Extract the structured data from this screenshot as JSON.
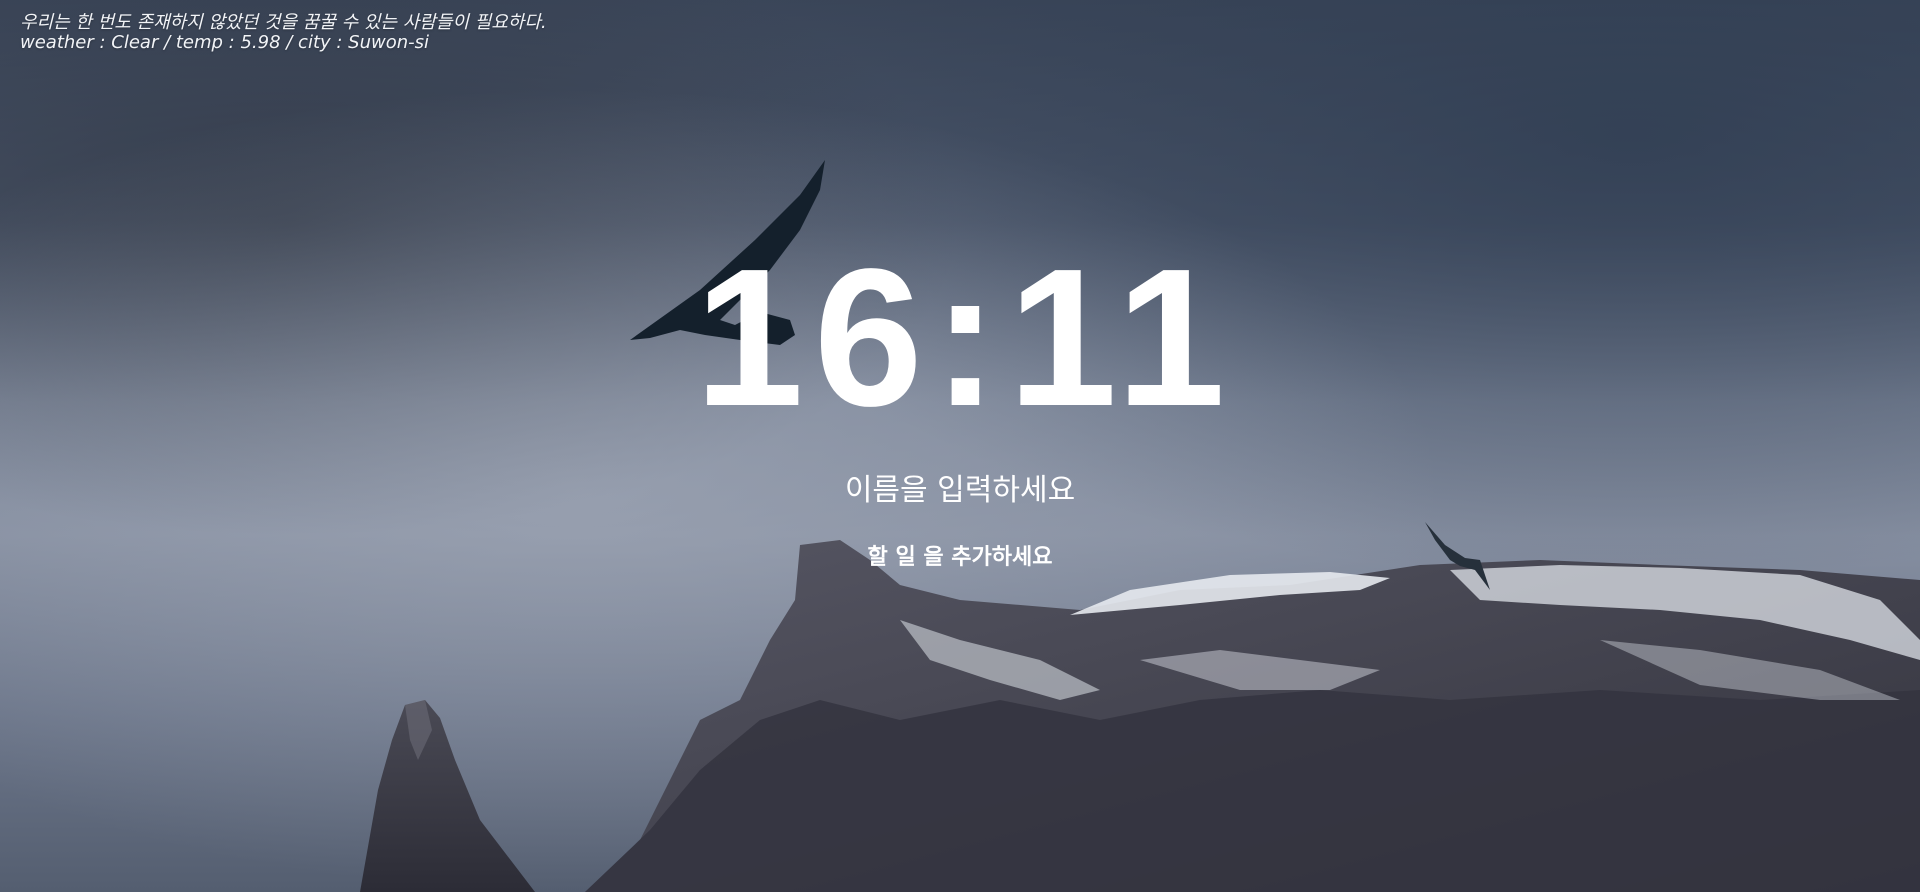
{
  "background": {
    "scene": "mountain-cliffs-with-seabirds"
  },
  "quote": {
    "text": "우리는 한 번도 존재하지 않았던 것을 꿈꿀 수 있는 사람들이 필요하다."
  },
  "weather": {
    "text": "weather : Clear / temp : 5.98 / city : Suwon-si"
  },
  "clock": {
    "time": "16:11"
  },
  "greeting_form": {
    "name_placeholder": "이름을 입력하세요",
    "name_value": ""
  },
  "todo_form": {
    "placeholder": "할 일 을 추가하세요",
    "value": ""
  }
}
